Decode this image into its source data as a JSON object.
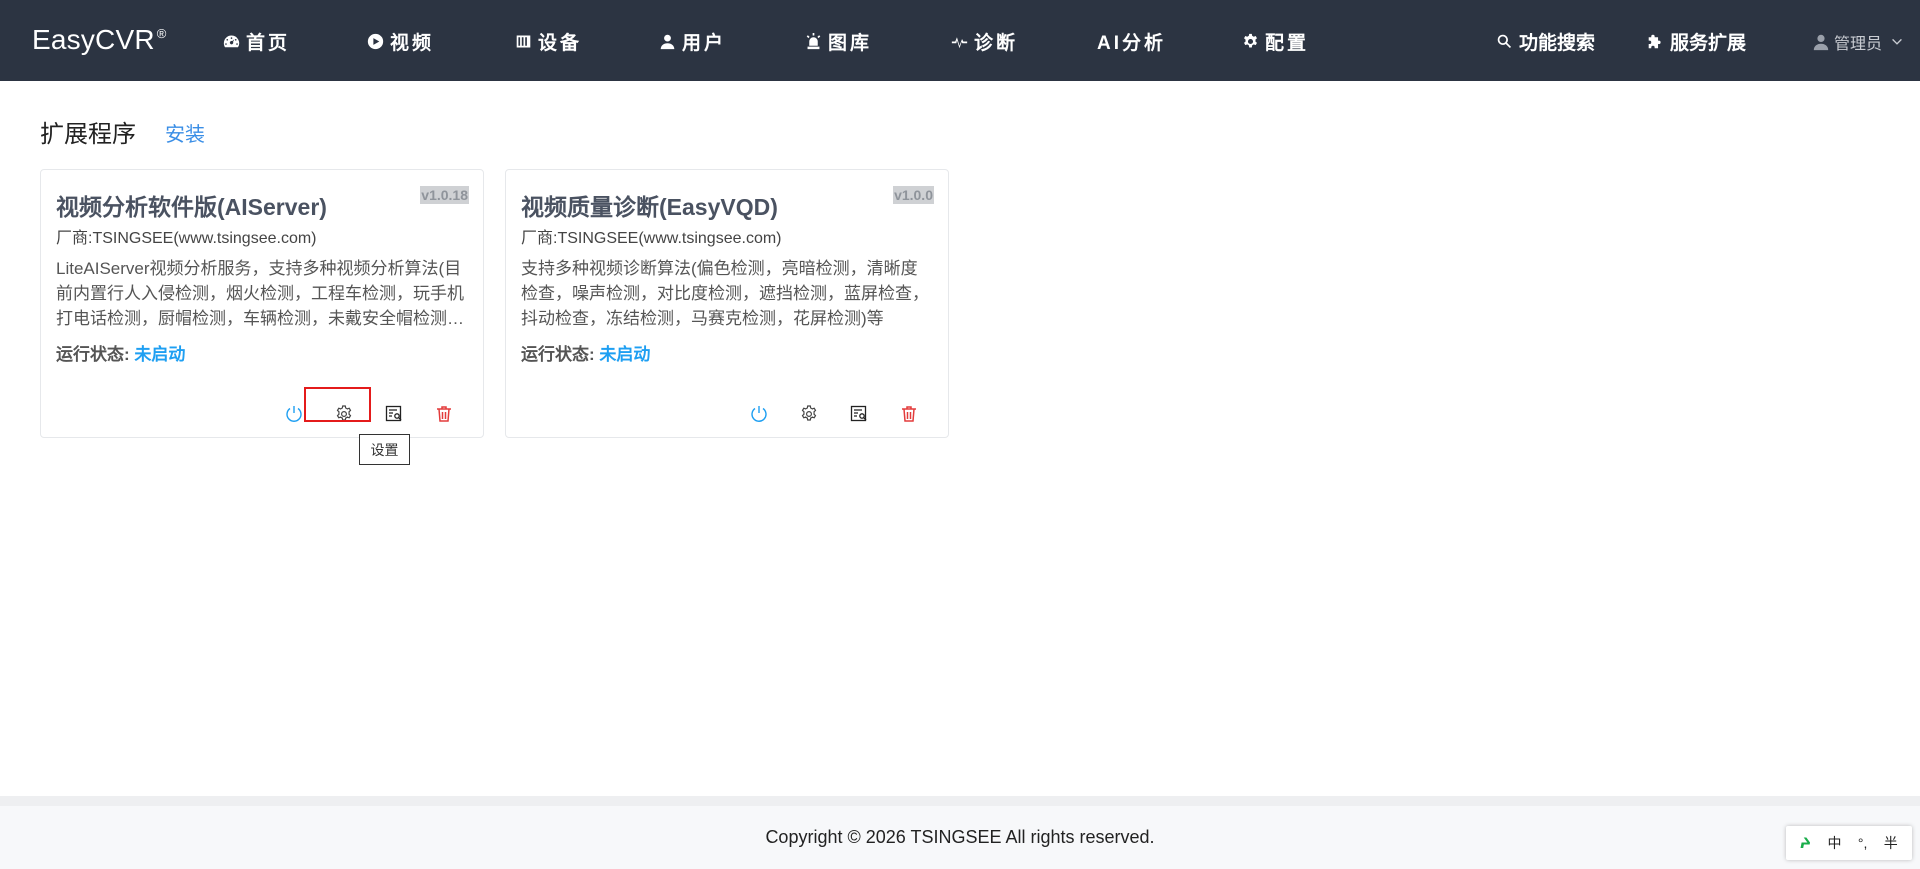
{
  "app": {
    "brand": "EasyCVR",
    "brand_mark": "®"
  },
  "nav": {
    "items": [
      {
        "label": "首页",
        "icon": "dashboard-icon"
      },
      {
        "label": "视频",
        "icon": "play-circle-icon"
      },
      {
        "label": "设备",
        "icon": "device-icon"
      },
      {
        "label": "用户",
        "icon": "user-icon"
      },
      {
        "label": "图库",
        "icon": "alarm-light-icon"
      },
      {
        "label": "诊断",
        "icon": "heartbeat-icon"
      },
      {
        "label": "AI分析",
        "icon": ""
      },
      {
        "label": "配置",
        "icon": "gear-icon"
      }
    ],
    "right_items": [
      {
        "label": "功能搜索",
        "icon": "search-icon"
      },
      {
        "label": "服务扩展",
        "icon": "puzzle-icon"
      }
    ],
    "user": "管理员"
  },
  "page": {
    "title": "扩展程序",
    "install_label": "安装"
  },
  "cards": [
    {
      "name": "视频分析软件版(AIServer)",
      "version": "v1.0.18",
      "vendor": "厂商:TSINGSEE(www.tsingsee.com)",
      "description": "LiteAIServer视频分析服务，支持多种视频分析算法(目前内置行人入侵检测，烟火检测，工程车检测，玩手机打电话检测，厨帽检测，车辆检测，未戴安全帽检测等)",
      "status_label": "运行状态:",
      "status_value": "未启动"
    },
    {
      "name": "视频质量诊断(EasyVQD)",
      "version": "v1.0.0",
      "vendor": "厂商:TSINGSEE(www.tsingsee.com)",
      "description": "支持多种视频诊断算法(偏色检测，亮暗检测，清晰度检查，噪声检测，对比度检测，遮挡检测，蓝屏检查，抖动检查，冻结检测，马赛克检测，花屏检测)等",
      "status_label": "运行状态:",
      "status_value": "未启动"
    }
  ],
  "tooltip": "设置",
  "footer": {
    "copyright": "Copyright © 2026 TSINGSEE All rights reserved."
  },
  "ime": {
    "mode": "中",
    "punct": "°,",
    "width": "半"
  },
  "colors": {
    "navbar": "#2c3442",
    "accent": "#1e9ff2",
    "link": "#3a8ee6",
    "danger": "#e33b3b",
    "highlight": "#e41b1b"
  }
}
